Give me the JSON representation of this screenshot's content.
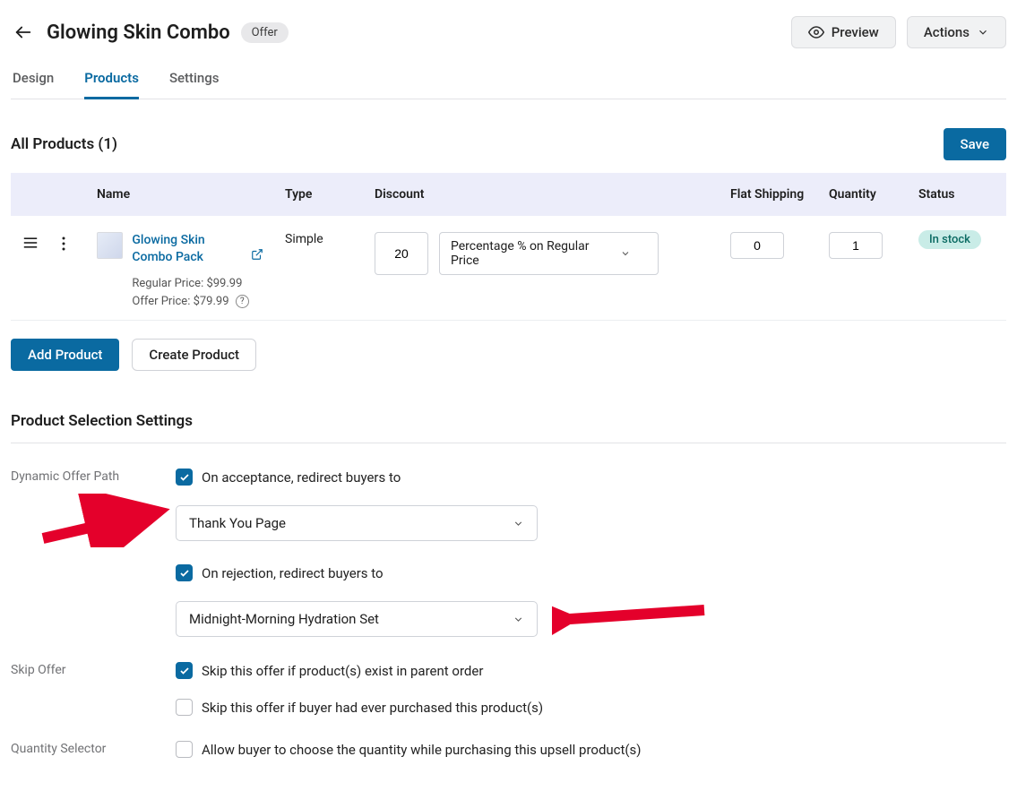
{
  "header": {
    "title": "Glowing Skin Combo",
    "badge": "Offer",
    "preview_label": "Preview",
    "actions_label": "Actions"
  },
  "tabs": {
    "design": "Design",
    "products": "Products",
    "settings_tab": "Settings"
  },
  "list": {
    "heading": "All Products (1)",
    "save_label": "Save",
    "cols": {
      "name": "Name",
      "type": "Type",
      "discount": "Discount",
      "flat_shipping": "Flat Shipping",
      "quantity": "Quantity",
      "status": "Status"
    },
    "row": {
      "product_name": "Glowing Skin Combo Pack",
      "regular_price_label": "Regular Price: $99.99",
      "offer_price_label": "Offer Price: $79.99",
      "type": "Simple",
      "discount_value": "20",
      "discount_type": "Percentage % on Regular Price",
      "flat_shipping": "0",
      "quantity": "1",
      "status": "In stock"
    },
    "add_product_label": "Add Product",
    "create_product_label": "Create Product"
  },
  "settings": {
    "heading": "Product Selection Settings",
    "dynamic_offer_path_label": "Dynamic Offer Path",
    "on_acceptance_label": "On acceptance, redirect buyers to",
    "acceptance_target": "Thank You Page",
    "on_rejection_label": "On rejection, redirect buyers to",
    "rejection_target": "Midnight-Morning Hydration Set",
    "skip_offer_label": "Skip Offer",
    "skip_parent_label": "Skip this offer if product(s) exist in parent order",
    "skip_purchased_label": "Skip this offer if buyer had ever purchased this product(s)",
    "quantity_selector_label": "Quantity Selector",
    "quantity_selector_text": "Allow buyer to choose the quantity while purchasing this upsell product(s)"
  }
}
